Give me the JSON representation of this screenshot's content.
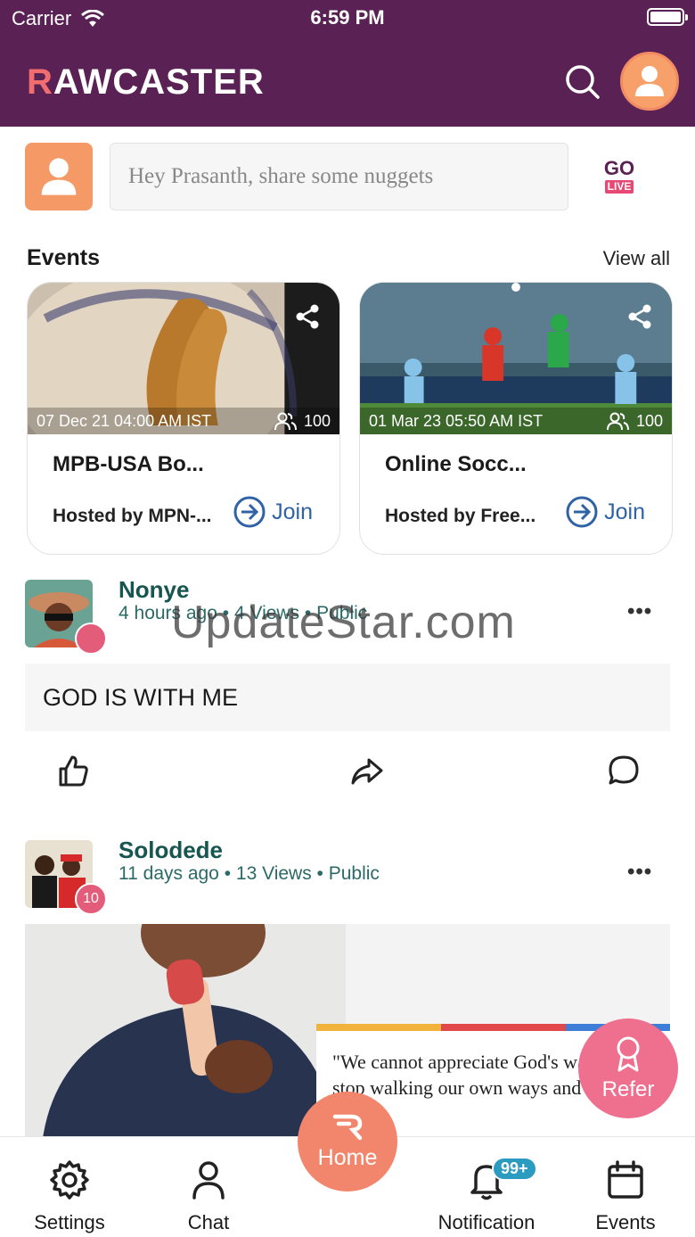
{
  "status_bar": {
    "carrier": "Carrier",
    "time": "6:59 PM"
  },
  "header": {
    "logo": "RAWCASTER",
    "logo_first": "R",
    "logo_rest": "AWCASTER"
  },
  "composer": {
    "placeholder": "Hey Prasanth, share some nuggets",
    "go": "GO",
    "live": "LIVE"
  },
  "events": {
    "title": "Events",
    "view_all": "View all",
    "items": [
      {
        "date": "07 Dec 21 04:00 AM IST",
        "attendees": "100",
        "name": "MPB-USA Bo...",
        "host": "Hosted by MPN-...",
        "join": "Join"
      },
      {
        "date": "01 Mar 23 05:50 AM IST",
        "attendees": "100",
        "name": "Online Socc...",
        "host": "Hosted by Free...",
        "join": "Join"
      }
    ]
  },
  "posts": [
    {
      "author": "Nonye",
      "meta": "4 hours ago • 4 Views • Public",
      "badge": "",
      "text": "GOD IS WITH ME"
    },
    {
      "author": "Solodede",
      "meta": "11 days ago • 13 Views • Public",
      "badge": "10",
      "quote": "\"We cannot appreciate God's ways until we stop walking our own ways and look up to"
    }
  ],
  "watermark": "UpdateStar.com",
  "refer": {
    "label": "Refer"
  },
  "nav": {
    "settings": "Settings",
    "chat": "Chat",
    "home": "Home",
    "notification": "Notification",
    "notification_badge": "99+",
    "events": "Events"
  },
  "colors": {
    "header": "#5a2254",
    "accent": "#f2866c",
    "teal": "#175550",
    "link": "#2f63a6",
    "refer": "#ef6f8f"
  }
}
